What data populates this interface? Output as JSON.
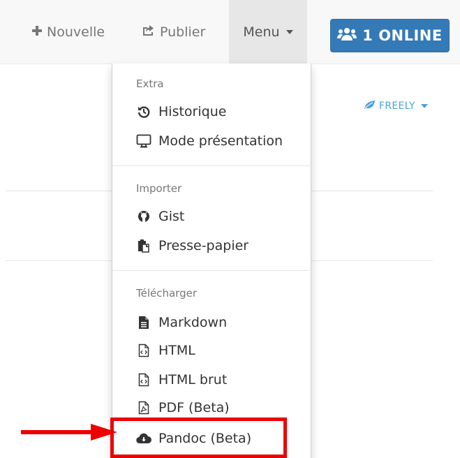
{
  "navbar": {
    "new_label": "Nouvelle",
    "publish_label": "Publier",
    "menu_label": "Menu",
    "online_label": "1 ONLINE"
  },
  "page": {
    "permission_label": "FREELY"
  },
  "menu": {
    "extra_header": "Extra",
    "history_label": "Historique",
    "presentation_label": "Mode présentation",
    "import_header": "Importer",
    "gist_label": "Gist",
    "clipboard_label": "Presse-papier",
    "download_header": "Télécharger",
    "markdown_label": "Markdown",
    "html_label": "HTML",
    "raw_html_label": "HTML brut",
    "pdf_label": "PDF (Beta)",
    "pandoc_label": "Pandoc (Beta)"
  },
  "colors": {
    "online_button": "#337ab7",
    "highlight": "#ee0000",
    "freely": "#4aa3df"
  },
  "icons": {
    "new": "plus-icon",
    "publish": "share-icon",
    "online": "users-icon",
    "freely": "leaf-icon",
    "history": "history-icon",
    "presentation": "desktop-icon",
    "gist": "github-icon",
    "clipboard": "paste-icon",
    "markdown": "file-text-icon",
    "html": "file-code-icon",
    "raw_html": "file-code-icon",
    "pdf": "file-pdf-icon",
    "pandoc": "cloud-download-icon"
  }
}
